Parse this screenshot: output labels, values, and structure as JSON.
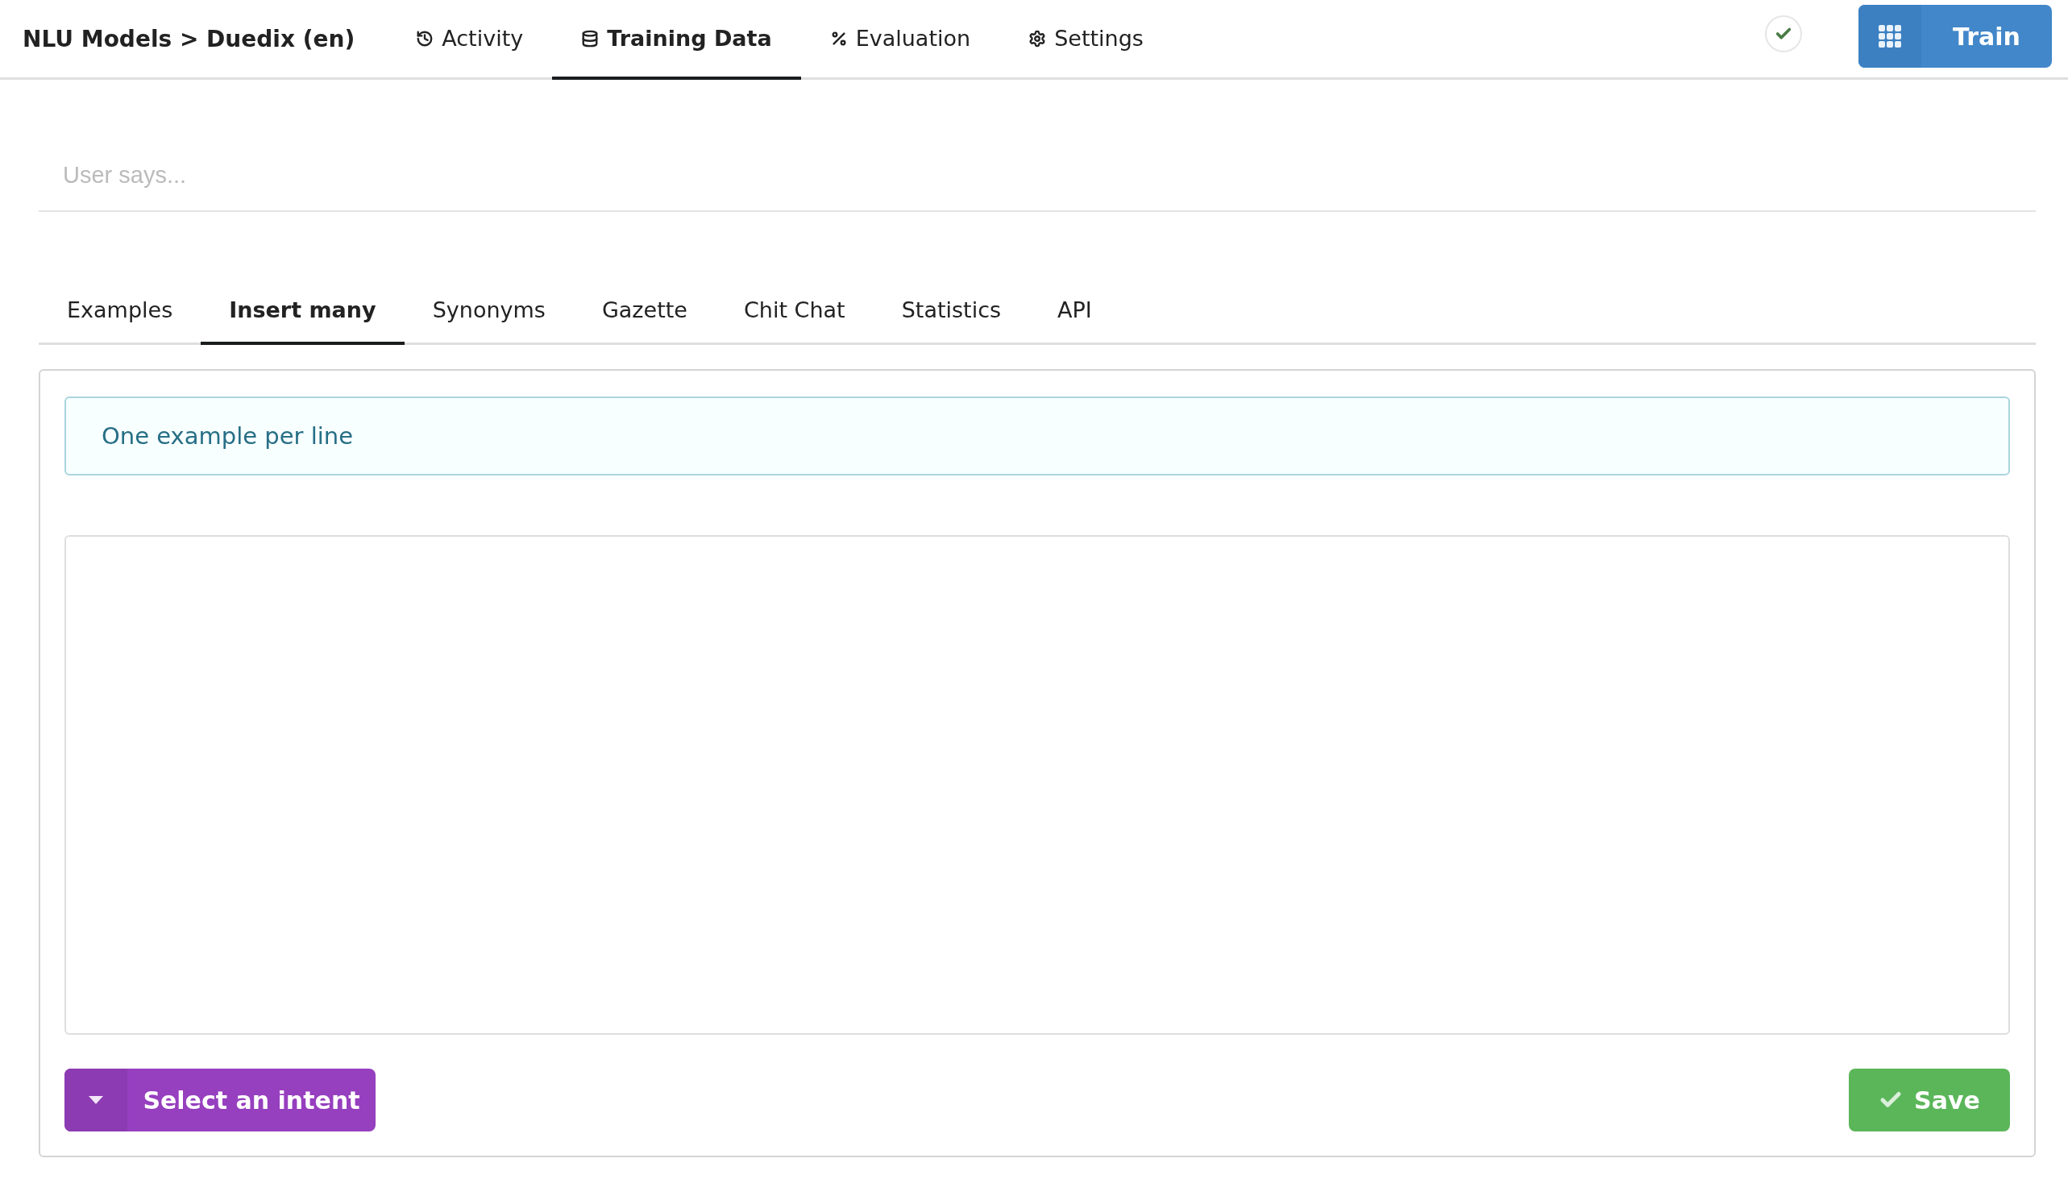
{
  "header": {
    "title": "NLU Models > Duedix (en)",
    "nav": [
      {
        "label": "Activity",
        "selected": false
      },
      {
        "label": "Training Data",
        "selected": true
      },
      {
        "label": "Evaluation",
        "selected": false
      },
      {
        "label": "Settings",
        "selected": false
      }
    ],
    "status_ok": true,
    "train_button": "Train"
  },
  "utterance": {
    "placeholder": "User says..."
  },
  "tabs": [
    {
      "label": "Examples",
      "selected": false
    },
    {
      "label": "Insert many",
      "selected": true
    },
    {
      "label": "Synonyms",
      "selected": false
    },
    {
      "label": "Gazette",
      "selected": false
    },
    {
      "label": "Chit Chat",
      "selected": false
    },
    {
      "label": "Statistics",
      "selected": false
    },
    {
      "label": "API",
      "selected": false
    }
  ],
  "panel": {
    "info": "One example per line",
    "intent_button": "Select an intent",
    "save_button": "Save"
  }
}
